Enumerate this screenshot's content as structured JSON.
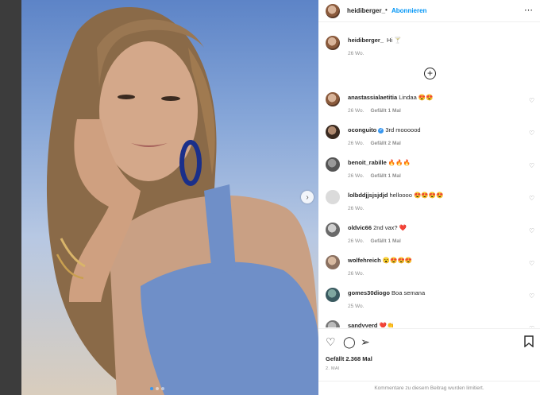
{
  "header": {
    "username": "heidiberger_",
    "separator": "•",
    "follow_label": "Abonnieren",
    "more_icon": "⋯"
  },
  "caption": {
    "username": "heidiberger_",
    "text": "Hi 🍸",
    "time": "26 Wo."
  },
  "load_more_icon": "+",
  "comments": [
    {
      "username": "anastassialaetitia",
      "text": "Lindaa 😍😍",
      "time": "26 Wo.",
      "likes": "Gefällt 1 Mal"
    },
    {
      "username": "oconguito",
      "verified": true,
      "text": "3rd moooood",
      "time": "26 Wo.",
      "likes": "Gefällt 2 Mal"
    },
    {
      "username": "benoit_rabille",
      "text": "🔥🔥🔥",
      "time": "26 Wo.",
      "likes": "Gefällt 1 Mal"
    },
    {
      "username": "lolbddjjsjsjdjd",
      "text": "helloooo 😍😍😍😍",
      "time": "26 Wo.",
      "likes": ""
    },
    {
      "username": "oldvic66",
      "text": "2nd vax? ❤️",
      "time": "26 Wo.",
      "likes": "Gefällt 1 Mal"
    },
    {
      "username": "wolfehreich",
      "text": "😮😍😍😍",
      "time": "26 Wo.",
      "likes": ""
    },
    {
      "username": "gomes30diogo",
      "text": "Boa semana",
      "time": "25 Wo.",
      "likes": ""
    },
    {
      "username": "sandyyerd",
      "text": "❤️👏",
      "time": "",
      "likes": ""
    }
  ],
  "actions": {
    "likes_count": "Gefällt 2.368 Mal",
    "date": "2. MAI"
  },
  "limited_text": "Kommentare zu diesem Beitrag wurden limitiert.",
  "colors": {
    "accent": "#0095f6",
    "text": "#262626",
    "muted": "#8e8e8e"
  }
}
